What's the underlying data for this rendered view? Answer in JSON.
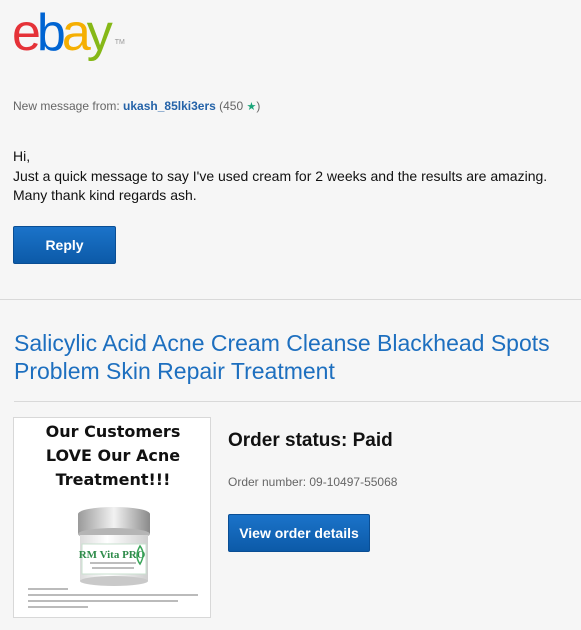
{
  "brand": {
    "logo_letters": [
      "e",
      "b",
      "a",
      "y"
    ],
    "logo_colors": [
      "#e53238",
      "#0064d2",
      "#f5af02",
      "#86b817"
    ],
    "trademark": "TM"
  },
  "message": {
    "from_prefix": "New message from:",
    "sender": "ukash_85lki3ers",
    "feedback_open": "(450",
    "feedback_close": ")",
    "feedback_star_icon": "star-icon",
    "greeting": "Hi,",
    "body_line1": "Just a quick message to say I've used cream for 2 weeks and the results are amazing.",
    "body_line2": "Many thank kind regards ash.",
    "reply_label": "Reply"
  },
  "product": {
    "title": "Salicylic Acid Acne Cream Cleanse Blackhead Spots Problem Skin Repair Treatment",
    "image_tagline_line1": "Our Customers",
    "image_tagline_line2": "LOVE Our Acne",
    "image_tagline_line3": "Treatment!!!",
    "jar_brand": "RM Vita PRO"
  },
  "order": {
    "status": "Order status: Paid",
    "number_label": "Order number: 09-10497-55068",
    "view_label": "View order details"
  },
  "colors": {
    "accent": "#1d6fbf",
    "button": "#0c5aa8"
  }
}
